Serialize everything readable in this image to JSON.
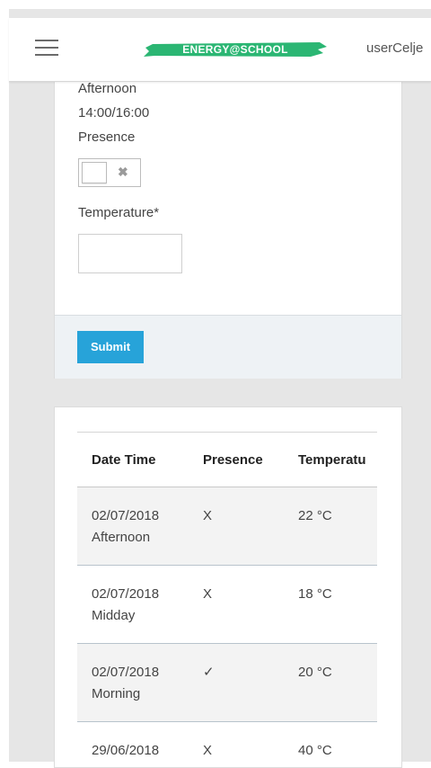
{
  "header": {
    "brand": "ENERGY@SCHOOL",
    "brand_color": "#2bb673",
    "user": "userCelje"
  },
  "form": {
    "period": "Afternoon",
    "time_range": "14:00/16:00",
    "presence_label": "Presence",
    "presence_toggle_icon": "✖",
    "temperature_label": "Temperature*",
    "temperature_value": "",
    "submit_label": "Submit"
  },
  "table": {
    "columns": [
      "Date Time",
      "Presence",
      "Temperatu"
    ],
    "rows": [
      {
        "date": "02/07/2018",
        "period": "Afternoon",
        "presence": "X",
        "temperature": "22 °C"
      },
      {
        "date": "02/07/2018",
        "period": "Midday",
        "presence": "X",
        "temperature": "18 °C"
      },
      {
        "date": "02/07/2018",
        "period": "Morning",
        "presence": "✓",
        "temperature": "20 °C"
      },
      {
        "date": "29/06/2018",
        "period": "",
        "presence": "X",
        "temperature": "40 °C"
      }
    ]
  }
}
